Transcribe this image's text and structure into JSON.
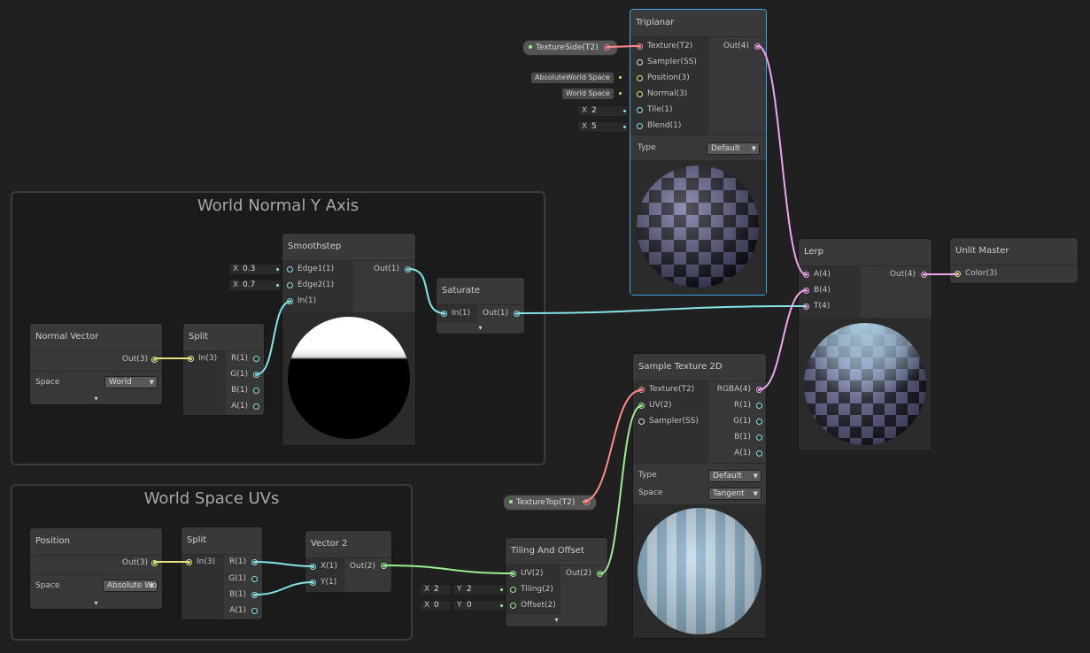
{
  "colors": {
    "vector3": "#e4e47d",
    "vector1": "#84e4e7",
    "vector2": "#9aef92",
    "vector4": "#f1a5ee",
    "texture": "#ff8b8b",
    "sampler": "#e0e0e0",
    "selection": "#3ea6df"
  },
  "groups": {
    "world_normal_title": "World Normal Y Axis",
    "world_space_uvs_title": "World Space UVs"
  },
  "normal_vector": {
    "title": "Normal Vector",
    "out": "Out(3)",
    "space_label": "Space",
    "space_value": "World"
  },
  "split1": {
    "title": "Split",
    "in": "In(3)",
    "r": "R(1)",
    "g": "G(1)",
    "b": "B(1)",
    "a": "A(1)"
  },
  "smoothstep": {
    "title": "Smoothstep",
    "edge1": "Edge1(1)",
    "edge2": "Edge2(1)",
    "in": "In(1)",
    "out": "Out(1)",
    "edge1_axis": "X",
    "edge1_value": "0.3",
    "edge2_axis": "X",
    "edge2_value": "0.7"
  },
  "saturate": {
    "title": "Saturate",
    "in": "In(1)",
    "out": "Out(1)"
  },
  "position": {
    "title": "Position",
    "out": "Out(3)",
    "space_label": "Space",
    "space_value": "Absolute Wo"
  },
  "split2": {
    "title": "Split",
    "in": "In(3)",
    "r": "R(1)",
    "g": "G(1)",
    "b": "B(1)",
    "a": "A(1)"
  },
  "vector2": {
    "title": "Vector 2",
    "x": "X(1)",
    "y": "Y(1)",
    "out": "Out(2)"
  },
  "tiling": {
    "title": "Tiling And Offset",
    "uv": "UV(2)",
    "tiling": "Tiling(2)",
    "offset": "Offset(2)",
    "out": "Out(2)",
    "tiling_x_axis": "X",
    "tiling_x": "2",
    "tiling_y_axis": "Y",
    "tiling_y": "2",
    "offset_x_axis": "X",
    "offset_x": "0",
    "offset_y_axis": "Y",
    "offset_y": "0"
  },
  "texture_top": {
    "label": "TextureTop(T2)"
  },
  "texture_side": {
    "label": "TextureSide(T2)"
  },
  "sample_tex": {
    "title": "Sample Texture 2D",
    "texture": "Texture(T2)",
    "uv": "UV(2)",
    "sampler": "Sampler(SS)",
    "rgba": "RGBA(4)",
    "r": "R(1)",
    "g": "G(1)",
    "b": "B(1)",
    "a": "A(1)",
    "type_label": "Type",
    "type_value": "Default",
    "space_label": "Space",
    "space_value": "Tangent"
  },
  "triplanar": {
    "title": "Triplanar",
    "texture": "Texture(T2)",
    "sampler": "Sampler(SS)",
    "position": "Position(3)",
    "normal": "Normal(3)",
    "tile": "Tile(1)",
    "blend": "Blend(1)",
    "out": "Out(4)",
    "type_label": "Type",
    "type_value": "Default",
    "position_default": "AbsoluteWorld Space",
    "normal_default": "World Space",
    "tile_axis": "X",
    "tile_value": "2",
    "blend_axis": "X",
    "blend_value": "5"
  },
  "lerp": {
    "title": "Lerp",
    "a": "A(4)",
    "b": "B(4)",
    "t": "T(4)",
    "out": "Out(4)"
  },
  "unlit": {
    "title": "Unlit Master",
    "color": "Color(3)"
  }
}
